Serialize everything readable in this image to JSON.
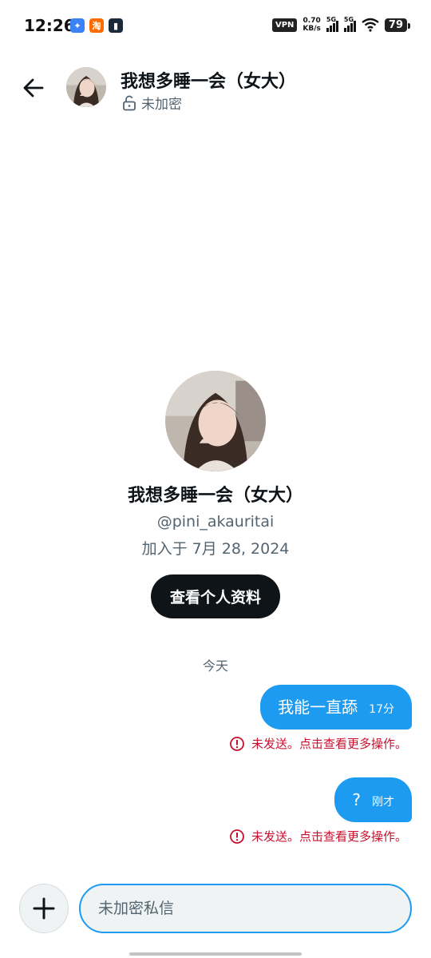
{
  "status_bar": {
    "time": "12:26",
    "apps": [
      "淘"
    ],
    "vpn": "VPN",
    "net_speed_value": "0.70",
    "net_speed_unit": "KB/s",
    "sim1": "5G",
    "sim2": "5G",
    "battery": "79"
  },
  "header": {
    "name": "我想多睡一会（女大）",
    "encryption": "未加密",
    "icons": {
      "back": "back-arrow-icon",
      "lock": "unlock-icon"
    }
  },
  "profile": {
    "name": "我想多睡一会（女大）",
    "handle": "@pini_akauritai",
    "joined": "加入于 7月 28, 2024",
    "view_button": "查看个人资料"
  },
  "conversation": {
    "date_separator": "今天",
    "messages": [
      {
        "text": "我能一直舔",
        "time": "17分",
        "error": "未发送。点击查看更多操作。"
      },
      {
        "text": "?",
        "time": "刚才",
        "error": "未发送。点击查看更多操作。"
      }
    ]
  },
  "composer": {
    "placeholder": "未加密私信",
    "icons": {
      "add": "plus-icon"
    }
  },
  "colors": {
    "accent": "#1d9bf0",
    "error": "#c8102e",
    "button_dark": "#0f1419",
    "secondary_text": "#536471"
  }
}
